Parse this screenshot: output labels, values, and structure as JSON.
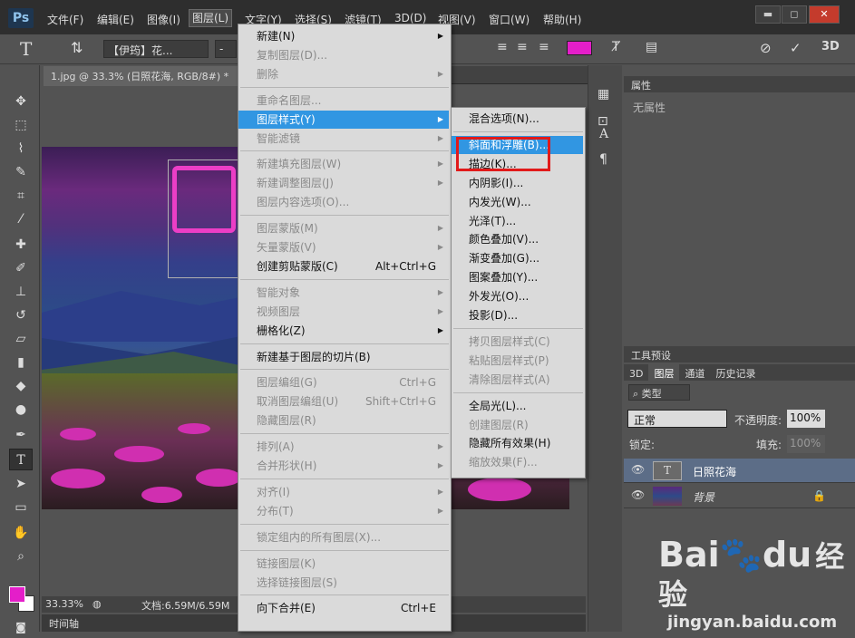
{
  "app": {
    "logo": "Ps"
  },
  "menubar": {
    "items": [
      "文件(F)",
      "编辑(E)",
      "图像(I)",
      "图层(L)",
      "文字(Y)",
      "选择(S)",
      "滤镜(T)",
      "3D(D)",
      "视图(V)",
      "窗口(W)",
      "帮助(H)"
    ],
    "active_index": 3
  },
  "window_controls": {
    "minimize": "▬",
    "restore": "◻",
    "close": "✕"
  },
  "options": {
    "font_name": "【伊筠】花...",
    "style": "-",
    "size": "",
    "three_d": "3D",
    "text_color": "#e41ec9"
  },
  "document": {
    "tab_title": "1.jpg @ 33.3% (日照花海, RGB/8#) *",
    "close": "×",
    "zoom": "33.33%",
    "doc_size": "文档:6.59M/6.59M",
    "timeline": "时间轴"
  },
  "colors": {
    "foreground": "#e41ec9",
    "background": "#ffffff",
    "highlight": "#3196e2",
    "annotation": "#e11a1a"
  },
  "properties": {
    "title": "属性",
    "empty": "无属性"
  },
  "tool_presets": {
    "title": "工具预设"
  },
  "layers_panel": {
    "tabs": [
      "3D",
      "图层",
      "通道",
      "历史记录"
    ],
    "active_tab": 1,
    "filter": "类型",
    "blend_mode": "正常",
    "opacity_label": "不透明度:",
    "opacity": "100%",
    "lock_label": "锁定:",
    "fill_label": "填充:",
    "fill": "100%",
    "layers": [
      {
        "name": "日照花海",
        "type": "text",
        "selected": true
      },
      {
        "name": "背景",
        "type": "image",
        "selected": false,
        "locked": true
      }
    ]
  },
  "layer_menu": {
    "items": [
      {
        "label": "新建(N)",
        "submenu": true
      },
      {
        "label": "复制图层(D)...",
        "disabled": true
      },
      {
        "label": "删除",
        "disabled": true,
        "submenu": true
      },
      {
        "sep": true
      },
      {
        "label": "重命名图层...",
        "disabled": true
      },
      {
        "label": "图层样式(Y)",
        "submenu": true,
        "highlight": true
      },
      {
        "label": "智能滤镜",
        "disabled": true,
        "submenu": true
      },
      {
        "sep": true
      },
      {
        "label": "新建填充图层(W)",
        "disabled": true,
        "submenu": true
      },
      {
        "label": "新建调整图层(J)",
        "disabled": true,
        "submenu": true
      },
      {
        "label": "图层内容选项(O)...",
        "disabled": true
      },
      {
        "sep": true
      },
      {
        "label": "图层蒙版(M)",
        "disabled": true,
        "submenu": true
      },
      {
        "label": "矢量蒙版(V)",
        "disabled": true,
        "submenu": true
      },
      {
        "label": "创建剪贴蒙版(C)",
        "shortcut": "Alt+Ctrl+G"
      },
      {
        "sep": true
      },
      {
        "label": "智能对象",
        "disabled": true,
        "submenu": true
      },
      {
        "label": "视频图层",
        "disabled": true,
        "submenu": true
      },
      {
        "label": "栅格化(Z)",
        "submenu": true
      },
      {
        "sep": true
      },
      {
        "label": "新建基于图层的切片(B)"
      },
      {
        "sep": true
      },
      {
        "label": "图层编组(G)",
        "disabled": true,
        "shortcut": "Ctrl+G"
      },
      {
        "label": "取消图层编组(U)",
        "disabled": true,
        "shortcut": "Shift+Ctrl+G"
      },
      {
        "label": "隐藏图层(R)",
        "disabled": true
      },
      {
        "sep": true
      },
      {
        "label": "排列(A)",
        "disabled": true,
        "submenu": true
      },
      {
        "label": "合并形状(H)",
        "disabled": true,
        "submenu": true
      },
      {
        "sep": true
      },
      {
        "label": "对齐(I)",
        "disabled": true,
        "submenu": true
      },
      {
        "label": "分布(T)",
        "disabled": true,
        "submenu": true
      },
      {
        "sep": true
      },
      {
        "label": "锁定组内的所有图层(X)...",
        "disabled": true
      },
      {
        "sep": true
      },
      {
        "label": "链接图层(K)",
        "disabled": true
      },
      {
        "label": "选择链接图层(S)",
        "disabled": true
      },
      {
        "sep": true
      },
      {
        "label": "向下合并(E)",
        "shortcut": "Ctrl+E"
      }
    ]
  },
  "style_submenu": {
    "items": [
      {
        "label": "混合选项(N)..."
      },
      {
        "sep": true
      },
      {
        "label": "斜面和浮雕(B)...",
        "highlight": true
      },
      {
        "label": "描边(K)..."
      },
      {
        "label": "内阴影(I)..."
      },
      {
        "label": "内发光(W)..."
      },
      {
        "label": "光泽(T)..."
      },
      {
        "label": "颜色叠加(V)..."
      },
      {
        "label": "渐变叠加(G)..."
      },
      {
        "label": "图案叠加(Y)..."
      },
      {
        "label": "外发光(O)..."
      },
      {
        "label": "投影(D)..."
      },
      {
        "sep": true
      },
      {
        "label": "拷贝图层样式(C)",
        "disabled": true
      },
      {
        "label": "粘贴图层样式(P)",
        "disabled": true
      },
      {
        "label": "清除图层样式(A)",
        "disabled": true
      },
      {
        "sep": true
      },
      {
        "label": "全局光(L)..."
      },
      {
        "label": "创建图层(R)",
        "disabled": true
      },
      {
        "label": "隐藏所有效果(H)"
      },
      {
        "label": "缩放效果(F)...",
        "disabled": true
      }
    ]
  },
  "watermark": {
    "brand": "Bai",
    "brand2": "du",
    "brand_cn": "经验",
    "url": "jingyan.baidu.com"
  }
}
